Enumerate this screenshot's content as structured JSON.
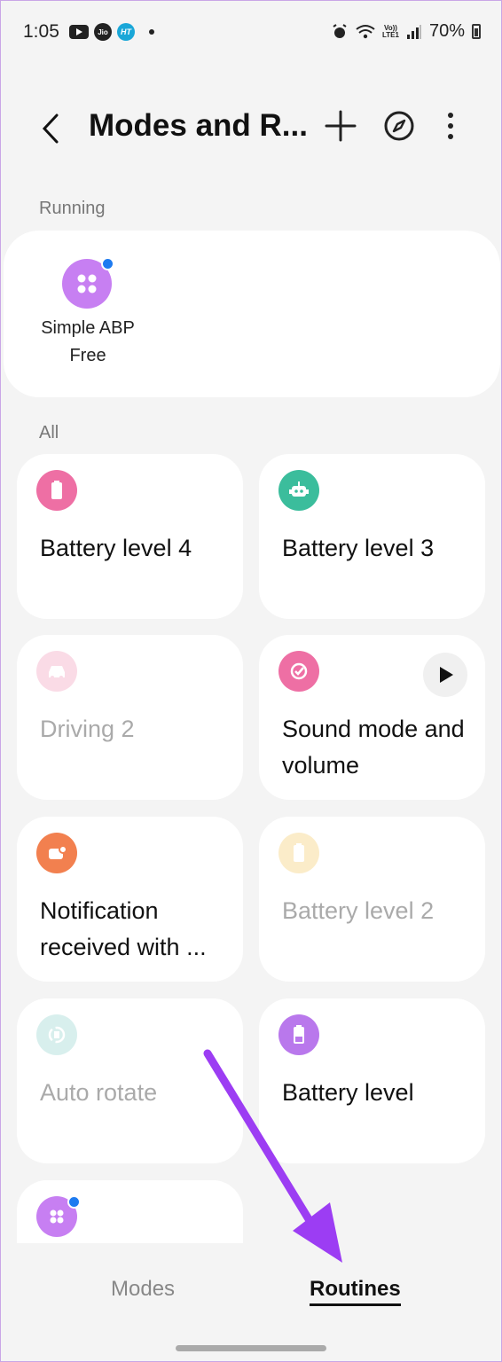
{
  "status_bar": {
    "time": "1:05",
    "jio": "Jio",
    "ht": "HT",
    "volte_top": "Vo))",
    "volte_bottom": "LTE1",
    "battery": "70%"
  },
  "header": {
    "title": "Modes and R..."
  },
  "running": {
    "section_label": "Running",
    "item_label": "Simple ABP Free"
  },
  "all": {
    "section_label": "All",
    "cards": [
      {
        "label": "Battery level 4",
        "icon": "battery-icon",
        "color": "#ee6fa4"
      },
      {
        "label": "Battery level 3",
        "icon": "robot-icon",
        "color": "#3bbd9c"
      },
      {
        "label": "Driving 2",
        "icon": "car-icon",
        "color": "#f3a6c3"
      },
      {
        "label": "Sound mode and volume",
        "icon": "check-circle-icon",
        "color": "#ee6fa4"
      },
      {
        "label": "Notification received with ...",
        "icon": "notification-icon",
        "color": "#f2804f"
      },
      {
        "label": "Battery level 2",
        "icon": "battery-icon",
        "color": "#f6d27a"
      },
      {
        "label": "Auto rotate",
        "icon": "rotate-icon",
        "color": "#9fd9d4"
      },
      {
        "label": "Battery level",
        "icon": "battery-icon",
        "color": "#b978ec"
      }
    ]
  },
  "bottom_nav": {
    "modes": "Modes",
    "routines": "Routines"
  },
  "colors": {
    "accent_purple": "#9c3df3",
    "badge_blue": "#1e7bf0"
  }
}
